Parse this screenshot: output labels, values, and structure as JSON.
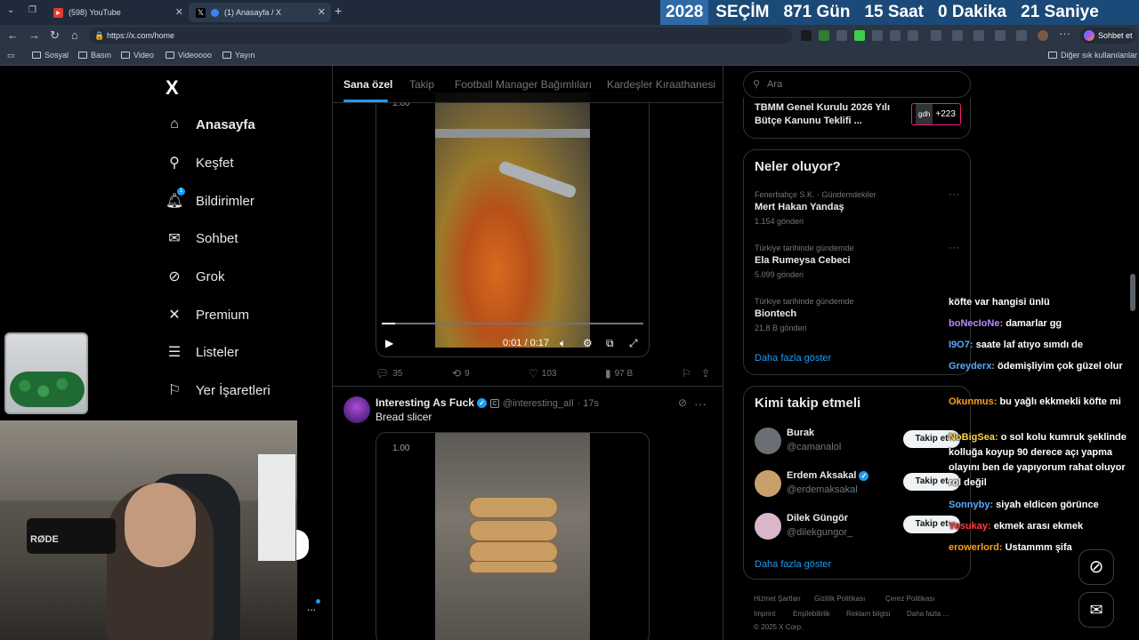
{
  "browser": {
    "tabs": [
      {
        "label": "(598) YouTube",
        "active": false
      },
      {
        "label": "(1) Anasayfa / X",
        "active": true
      }
    ],
    "new_tab": "+",
    "close": "✕",
    "url": "https://x.com/home",
    "chat_button": "Sohbet et",
    "bookmarks": [
      "Sosyal",
      "Basın",
      "Video",
      "Videoooo",
      "Yayın"
    ],
    "other_bookmarks": "Diğer sık kullanılanlar"
  },
  "countdown": {
    "year": "2028",
    "election": "SEÇİM",
    "days": "871 Gün",
    "hours": "15 Saat",
    "minutes": "0 Dakika",
    "seconds": "21 Saniye"
  },
  "nav": {
    "logo": "X",
    "items": [
      "Anasayfa",
      "Keşfet",
      "Bildirimler",
      "Sohbet",
      "Grok",
      "Premium",
      "Listeler",
      "Yer İşaretleri"
    ],
    "notif_badge": "1",
    "more": "..."
  },
  "webcam": {
    "mic_brand": "RØDE"
  },
  "feed": {
    "tabs": [
      "Sana özel",
      "Takip",
      "Football Manager Bağımlıları",
      "Kardeşler Kıraathanesi"
    ],
    "video1": {
      "zoom": "1.00",
      "time": "0:01 / 0:17",
      "progress": 0.05,
      "replies": "35",
      "reposts": "9",
      "likes": "103",
      "views": "97 B"
    },
    "tweet2": {
      "name": "Interesting As Fuck",
      "badge": "C",
      "handle": "@interesting_aIl",
      "time": "· 17s",
      "text": "Bread slicer",
      "zoom": "1.00"
    }
  },
  "right": {
    "search_placeholder": "Ara",
    "promo": {
      "text": "TBMM Genel Kurulu 2026 Yılı Bütçe Kanunu Teklifi ...",
      "badge_tag": "gdh",
      "badge_count": "+223"
    },
    "trends_title": "Neler oluyor?",
    "trends": [
      {
        "ctx": "Fenerbahçe S.K. · Gündemdekiler",
        "name": "Mert Hakan Yandaş",
        "count": "1.154 gönderi"
      },
      {
        "ctx": "Türkiye tarihinde gündemde",
        "name": "Ela Rumeysa Cebeci",
        "count": "5.099 gönderi"
      },
      {
        "ctx": "Türkiye tarihinde gündemde",
        "name": "Biontech",
        "count": "21,8 B gönderi"
      }
    ],
    "show_more": "Daha fazla göster",
    "follow_title": "Kimi takip etmeli",
    "follow": [
      {
        "name": "Burak",
        "handle": "@camanalol",
        "verified": false,
        "color": "#6b6f75"
      },
      {
        "name": "Erdem Aksakal",
        "handle": "@erdemaksakal",
        "verified": true,
        "color": "#c9a06b"
      },
      {
        "name": "Dilek Güngör",
        "handle": "@dilekgungor_",
        "verified": false,
        "color": "#d9b6c9"
      }
    ],
    "follow_label": "Takip et",
    "footer": [
      "Hizmet Şartları",
      "Gizlilik Politikası",
      "Çerez Politikası",
      "Imprint",
      "Erişilebilirlik",
      "Reklam bilgisi",
      "Daha fazla ...",
      "© 2025 X Corp."
    ]
  },
  "chat": [
    {
      "user": "",
      "text": "köfte var hangisi ünlü",
      "color": "#ffffff"
    },
    {
      "user": "boNecIoNe:",
      "text": "damarlar gg",
      "color": "#b98cff"
    },
    {
      "user": "I9O7:",
      "text": "saate laf atıyo sımdı de",
      "color": "#5aa9ff"
    },
    {
      "user": "Greyderx:",
      "text": "ödemişliyim çok güzel olur",
      "color": "#5aa9ff"
    },
    {
      "user": "Okunmus:",
      "text": "bu yağlı ekkmekli köfte mi",
      "color": "#ff9f1a"
    },
    {
      "user": "NoBigSea:",
      "text": "o sol kolu kumruk şeklinde kolluğa koyup 90 derece açı yapma olayını ben de yapıyorum rahat oluyor rol değil",
      "color": "#ffd23f"
    },
    {
      "user": "Sonnyby:",
      "text": "siyah eldicen görünce",
      "color": "#5aa9ff"
    },
    {
      "user": "Yesukay:",
      "text": "ekmek arası ekmek",
      "color": "#ff3b3b"
    },
    {
      "user": "erowerlord:",
      "text": "Ustammm şifa",
      "color": "#ff9f1a"
    }
  ]
}
